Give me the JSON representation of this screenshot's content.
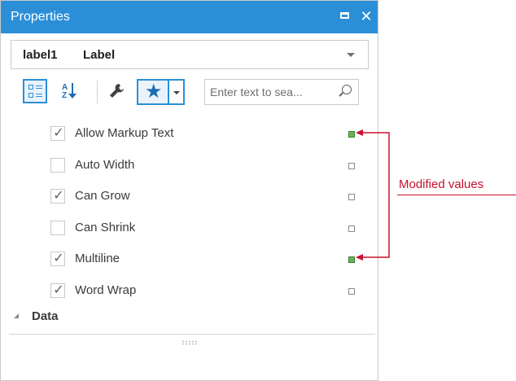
{
  "window": {
    "title": "Properties"
  },
  "object_selector": {
    "name": "label1",
    "type": "Label"
  },
  "search": {
    "placeholder": "Enter text to sea..."
  },
  "properties": [
    {
      "label": "Allow Markup Text",
      "checked": true,
      "modified": true
    },
    {
      "label": "Auto Width",
      "checked": false,
      "modified": false
    },
    {
      "label": "Can Grow",
      "checked": true,
      "modified": false
    },
    {
      "label": "Can Shrink",
      "checked": false,
      "modified": false
    },
    {
      "label": "Multiline",
      "checked": true,
      "modified": true
    },
    {
      "label": "Word Wrap",
      "checked": true,
      "modified": false
    }
  ],
  "category": {
    "label": "Data"
  },
  "annotation": {
    "text": "Modified values"
  },
  "colors": {
    "accent": "#2b8fd8",
    "annotation": "#c8102e",
    "modified_indicator": "#68b35a"
  },
  "icons": {
    "maximize": "maximize-icon",
    "close": "close-icon",
    "dropdown": "chevron-down-icon",
    "categorized": "categorized-view-icon",
    "alphabetical": "sort-alphabetical-icon",
    "wrench": "wrench-icon",
    "star": "star-icon",
    "search": "search-icon",
    "collapse": "collapse-triangle-icon"
  }
}
